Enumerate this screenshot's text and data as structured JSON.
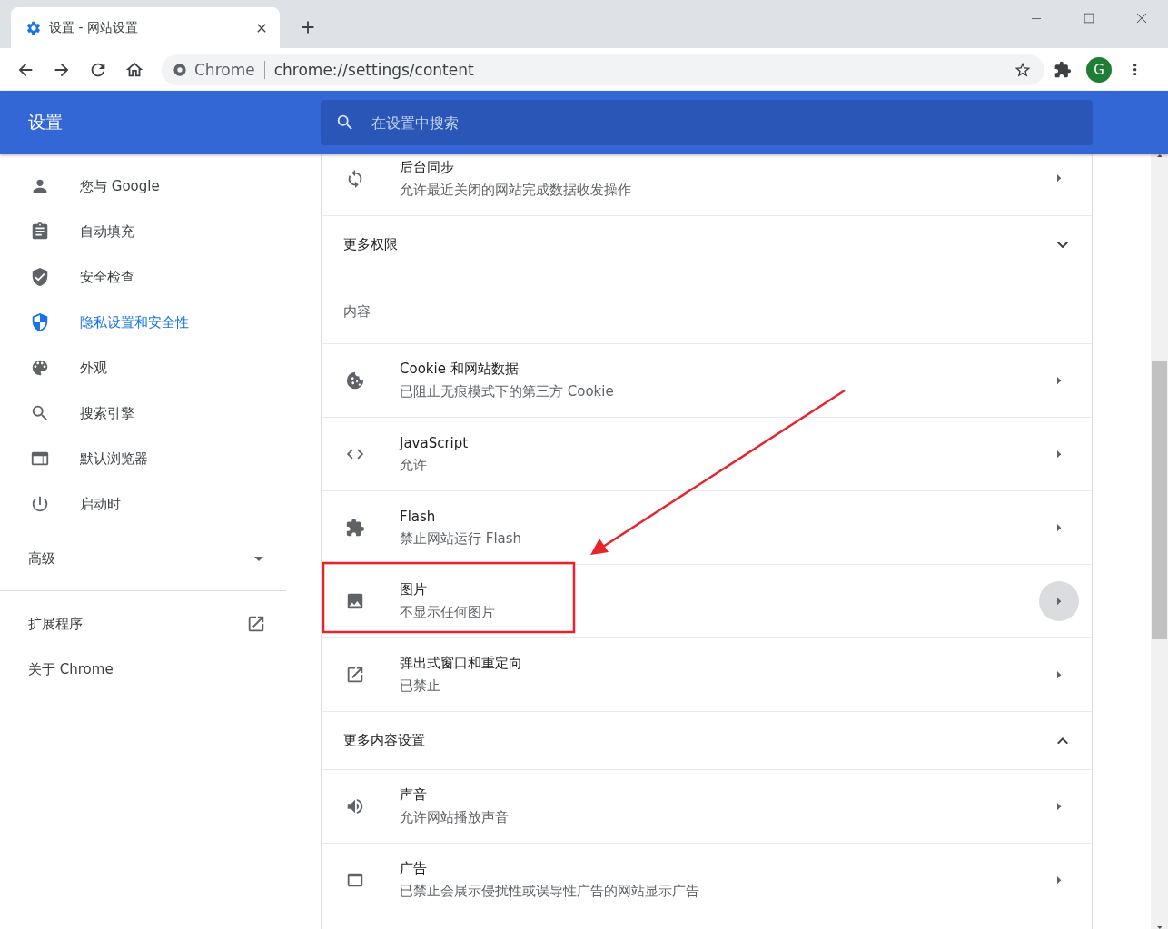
{
  "browser": {
    "tabs": [
      {
        "title": "设置 - 网站设置",
        "selected": true
      }
    ],
    "omnibox": {
      "site_label": "Chrome",
      "url": "chrome://settings/content"
    },
    "profile": {
      "initial": "G"
    }
  },
  "header": {
    "title": "设置",
    "search": {
      "placeholder": "在设置中搜索"
    }
  },
  "sidebar": {
    "items": [
      {
        "label": "您与 Google",
        "selected": false
      },
      {
        "label": "自动填充",
        "selected": false
      },
      {
        "label": "安全检查",
        "selected": false
      },
      {
        "label": "隐私设置和安全性",
        "selected": true
      },
      {
        "label": "外观",
        "selected": false
      },
      {
        "label": "搜索引擎",
        "selected": false
      },
      {
        "label": "默认浏览器",
        "selected": false
      },
      {
        "label": "启动时",
        "selected": false
      }
    ],
    "advanced": {
      "label": "高级",
      "expanded": false
    },
    "links": [
      {
        "label": "扩展程序",
        "external": true
      },
      {
        "label": "关于 Chrome",
        "external": false
      }
    ]
  },
  "content": [
    {
      "kind": "row",
      "title": "后台同步",
      "subtitle": "允许最近关闭的网站完成数据收发操作",
      "hovered": false
    },
    {
      "kind": "section",
      "label": "更多权限",
      "expanded": false
    },
    {
      "kind": "heading",
      "label": "内容"
    },
    {
      "kind": "row",
      "title": "Cookie 和网站数据",
      "subtitle": "已阻止无痕模式下的第三方 Cookie",
      "hovered": false
    },
    {
      "kind": "row",
      "title": "JavaScript",
      "subtitle": "允许",
      "hovered": false
    },
    {
      "kind": "row",
      "title": "Flash",
      "subtitle": "禁止网站运行 Flash",
      "hovered": false
    },
    {
      "kind": "row",
      "title": "图片",
      "subtitle": "不显示任何图片",
      "hovered": true
    },
    {
      "kind": "row",
      "title": "弹出式窗口和重定向",
      "subtitle": "已禁止",
      "hovered": false
    },
    {
      "kind": "section",
      "label": "更多内容设置",
      "expanded": true
    },
    {
      "kind": "row",
      "title": "声音",
      "subtitle": "允许网站播放声音",
      "hovered": false
    },
    {
      "kind": "row",
      "title": "广告",
      "subtitle": "已禁止会展示侵扰性或误导性广告的网站显示广告",
      "hovered": false
    }
  ]
}
